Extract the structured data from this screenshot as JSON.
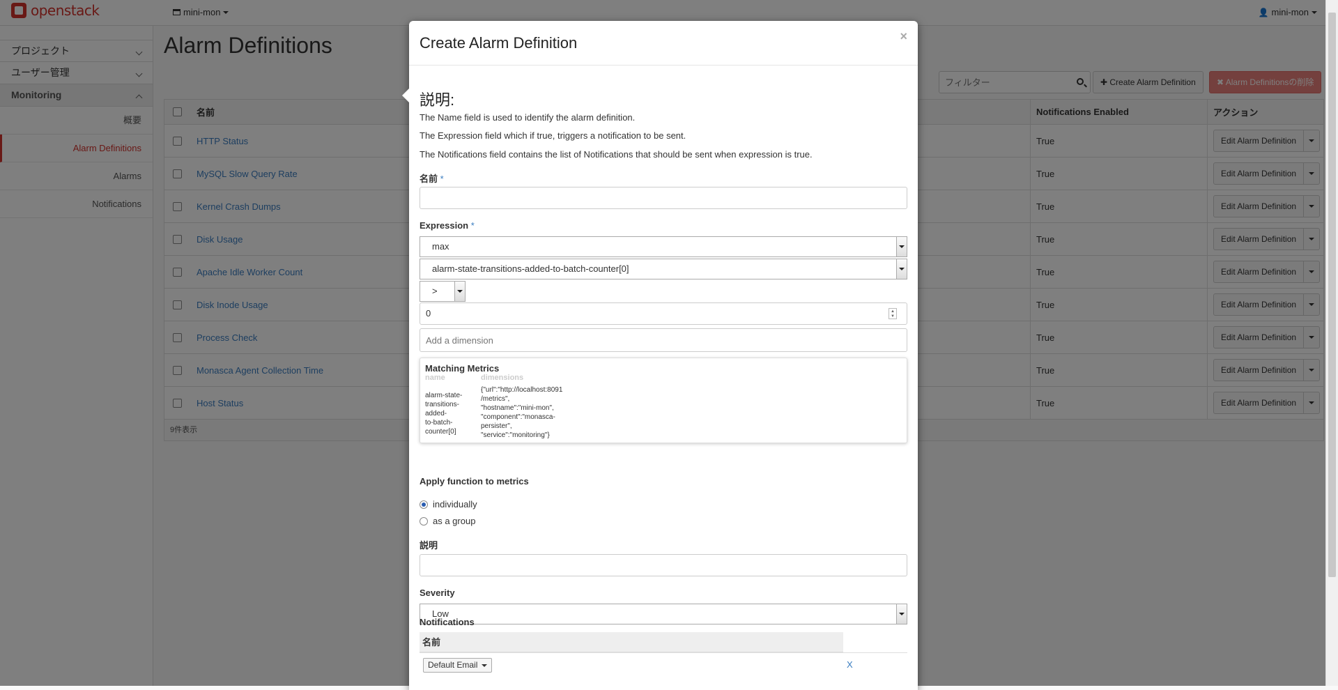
{
  "topbar": {
    "brand": "openstack",
    "project": "mini-mon",
    "user": "mini-mon"
  },
  "sidebar": {
    "sections": [
      {
        "label": "プロジェクト",
        "expanded": false
      },
      {
        "label": "ユーザー管理",
        "expanded": false
      },
      {
        "label": "Monitoring",
        "expanded": true
      }
    ],
    "items": [
      {
        "label": "概要",
        "active": false
      },
      {
        "label": "Alarm Definitions",
        "active": true
      },
      {
        "label": "Alarms",
        "active": false
      },
      {
        "label": "Notifications",
        "active": false
      }
    ]
  },
  "page": {
    "title": "Alarm Definitions",
    "filter_placeholder": "フィルター",
    "create_label": "✚ Create Alarm Definition",
    "delete_label": "✖ Alarm Definitionsの削除"
  },
  "table": {
    "headers": {
      "name": "名前",
      "notifications": "Notifications Enabled",
      "actions": "アクション"
    },
    "rows": [
      {
        "name": "HTTP Status",
        "enabled": "True",
        "action": "Edit Alarm Definition"
      },
      {
        "name": "MySQL Slow Query Rate",
        "enabled": "True",
        "action": "Edit Alarm Definition"
      },
      {
        "name": "Kernel Crash Dumps",
        "enabled": "True",
        "action": "Edit Alarm Definition"
      },
      {
        "name": "Disk Usage",
        "enabled": "True",
        "action": "Edit Alarm Definition"
      },
      {
        "name": "Apache Idle Worker Count",
        "enabled": "True",
        "action": "Edit Alarm Definition"
      },
      {
        "name": "Disk Inode Usage",
        "enabled": "True",
        "action": "Edit Alarm Definition"
      },
      {
        "name": "Process Check",
        "enabled": "True",
        "action": "Edit Alarm Definition"
      },
      {
        "name": "Monasca Agent Collection Time",
        "enabled": "True",
        "action": "Edit Alarm Definition"
      },
      {
        "name": "Host Status",
        "enabled": "True",
        "action": "Edit Alarm Definition"
      }
    ],
    "footer": "9件表示"
  },
  "modal": {
    "title": "Create Alarm Definition",
    "close": "×",
    "description_heading": "説明:",
    "description_lines": [
      "The Name field is used to identify the alarm definition.",
      "The Expression field which if true, triggers a notification to be sent.",
      "The Notifications field contains the list of Notifications that should be sent when expression is true."
    ],
    "name_label": "名前",
    "required_mark": "*",
    "name_value": "",
    "expression_label": "Expression",
    "expr_function": "max",
    "expr_metric": "alarm-state-transitions-added-to-batch-counter[0]",
    "expr_operator": ">",
    "expr_threshold": "0",
    "dimension_placeholder": "Add a dimension",
    "matching": {
      "title": "Matching Metrics",
      "col_name": "name",
      "col_dimensions": "dimensions",
      "name_lines": [
        "alarm-state-",
        "transitions-",
        "added-",
        "to-batch-",
        "counter[0]"
      ],
      "dim_lines": [
        "{\"url\":\"http://localhost:8091",
        "/metrics\",",
        "\"hostname\":\"mini-mon\",",
        "\"component\":\"monasca-",
        "persister\",",
        "\"service\":\"monitoring\"}"
      ]
    },
    "apply_label": "Apply function to metrics",
    "apply_options": [
      {
        "label": "individually",
        "selected": true
      },
      {
        "label": "as a group",
        "selected": false
      }
    ],
    "description_label": "説明",
    "description_value": "",
    "severity_label": "Severity",
    "severity_value": "Low",
    "notifications_label": "Notifications",
    "notif_col": "名前",
    "notif_row_value": "Default Email",
    "notif_remove": "X"
  },
  "colors": {
    "brand": "#d2322d",
    "link": "#3a7dc0",
    "danger": "#e8807c"
  }
}
